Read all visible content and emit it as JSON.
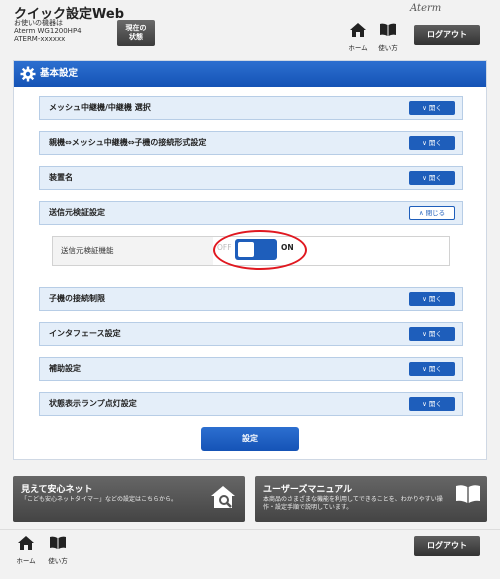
{
  "header": {
    "title": "クイック設定Web",
    "device_label": "お使いの機器は",
    "device_model": "Aterm WG1200HP4",
    "device_id": "ATERM-xxxxxx",
    "status_button": [
      "現在の",
      "状態"
    ],
    "home_label": "ホーム",
    "manual_label": "使い方",
    "brand": "Aterm",
    "logout_label": "ログアウト"
  },
  "panel": {
    "title": "基本設定",
    "rows": [
      {
        "label": "メッシュ中継機/中継機 選択",
        "button": "開く"
      },
      {
        "label": "親機⇔メッシュ中継機⇔子機の接続形式設定",
        "button": "開く"
      },
      {
        "label": "装置名",
        "button": "開く"
      },
      {
        "label": "送信元検証設定",
        "button": "閉じる"
      },
      {
        "label": "子機の接続制限",
        "button": "開く"
      },
      {
        "label": "インタフェース設定",
        "button": "開く"
      },
      {
        "label": "補助設定",
        "button": "開く"
      },
      {
        "label": "状態表示ランプ点灯設定",
        "button": "開く"
      }
    ],
    "sub_setting": {
      "label": "送信元検証機能",
      "off_text": "OFF",
      "on_text": "ON",
      "value": "ON"
    },
    "apply_label": "設定"
  },
  "banners": {
    "left": {
      "title": "見えて安心ネット",
      "desc": "「こども安心ネットタイマー」などの設定はこちらから。"
    },
    "right": {
      "title": "ユーザーズマニュアル",
      "desc": [
        "本商品のさまざまな機能を利用してできることを、わかりやすい操",
        "作・設定手順で説明しています。"
      ]
    }
  },
  "footer": {
    "home_label": "ホーム",
    "manual_label": "使い方",
    "logout_label": "ログアウト"
  },
  "colors": {
    "accent": "#1e5ebb",
    "row_bg": "#e4eef9",
    "highlight": "#e01820",
    "dark_button": "#444444"
  }
}
